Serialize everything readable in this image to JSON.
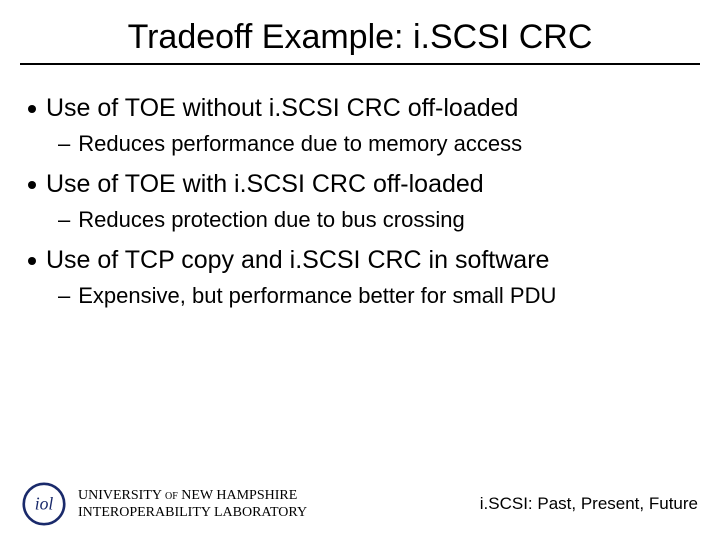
{
  "title": "Tradeoff Example: i.SCSI CRC",
  "bullets": [
    {
      "text": "Use of TOE without i.SCSI CRC off-loaded",
      "subs": [
        "Reduces performance due to memory access"
      ]
    },
    {
      "text": "Use of TOE with i.SCSI CRC off-loaded",
      "subs": [
        "Reduces protection due to bus crossing"
      ]
    },
    {
      "text": "Use of TCP copy and i.SCSI CRC in software",
      "subs": [
        "Expensive, but performance better for small PDU"
      ]
    }
  ],
  "footer": {
    "org_line1": "UNIVERSITY of NEW HAMPSHIRE",
    "org_line2": "INTEROPERABILITY LABORATORY",
    "tagline": "i.SCSI: Past, Present, Future"
  },
  "icons": {
    "logo": "iol-logo"
  }
}
